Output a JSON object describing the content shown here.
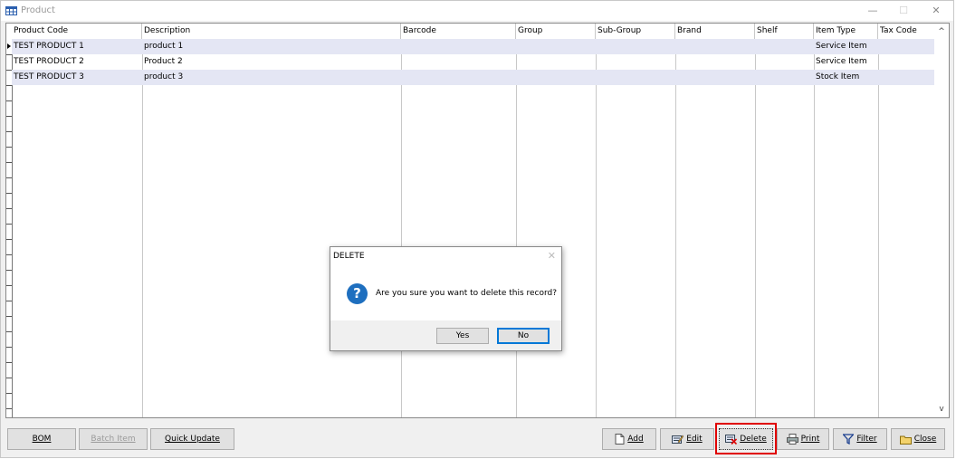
{
  "window": {
    "title": "Product",
    "minimize": "—",
    "maximize": "☐",
    "close": "✕"
  },
  "grid": {
    "columns": [
      "Product Code",
      "Description",
      "Barcode",
      "Group",
      "Sub-Group",
      "Brand",
      "Shelf",
      "Item Type",
      "Tax Code"
    ],
    "rows": [
      {
        "code": "TEST PRODUCT 1",
        "description": "product 1",
        "barcode": "",
        "group": "",
        "subgroup": "",
        "brand": "",
        "shelf": "",
        "item_type": "Service Item",
        "tax_code": ""
      },
      {
        "code": "TEST PRODUCT 2",
        "description": "Product 2",
        "barcode": "",
        "group": "",
        "subgroup": "",
        "brand": "",
        "shelf": "",
        "item_type": "Service Item",
        "tax_code": ""
      },
      {
        "code": "TEST PRODUCT 3",
        "description": "product 3",
        "barcode": "",
        "group": "",
        "subgroup": "",
        "brand": "",
        "shelf": "",
        "item_type": "Stock Item",
        "tax_code": ""
      }
    ],
    "scroll_up": "^",
    "scroll_down": "v"
  },
  "toolbar": {
    "bom": "BOM",
    "batch_item": "Batch Item",
    "quick_update": "Quick Update",
    "add": "Add",
    "edit": "Edit",
    "delete": "Delete",
    "print": "Print",
    "filter": "Filter",
    "close": "Close"
  },
  "dialog": {
    "title": "DELETE",
    "close": "✕",
    "icon": "?",
    "message": "Are you sure you want to delete this record?",
    "yes": "Yes",
    "no": "No"
  },
  "colors": {
    "row_alt": "#e4e6f4",
    "highlight": "#e00000",
    "question_icon": "#1e6fbf",
    "default_button_border": "#0078d7"
  }
}
